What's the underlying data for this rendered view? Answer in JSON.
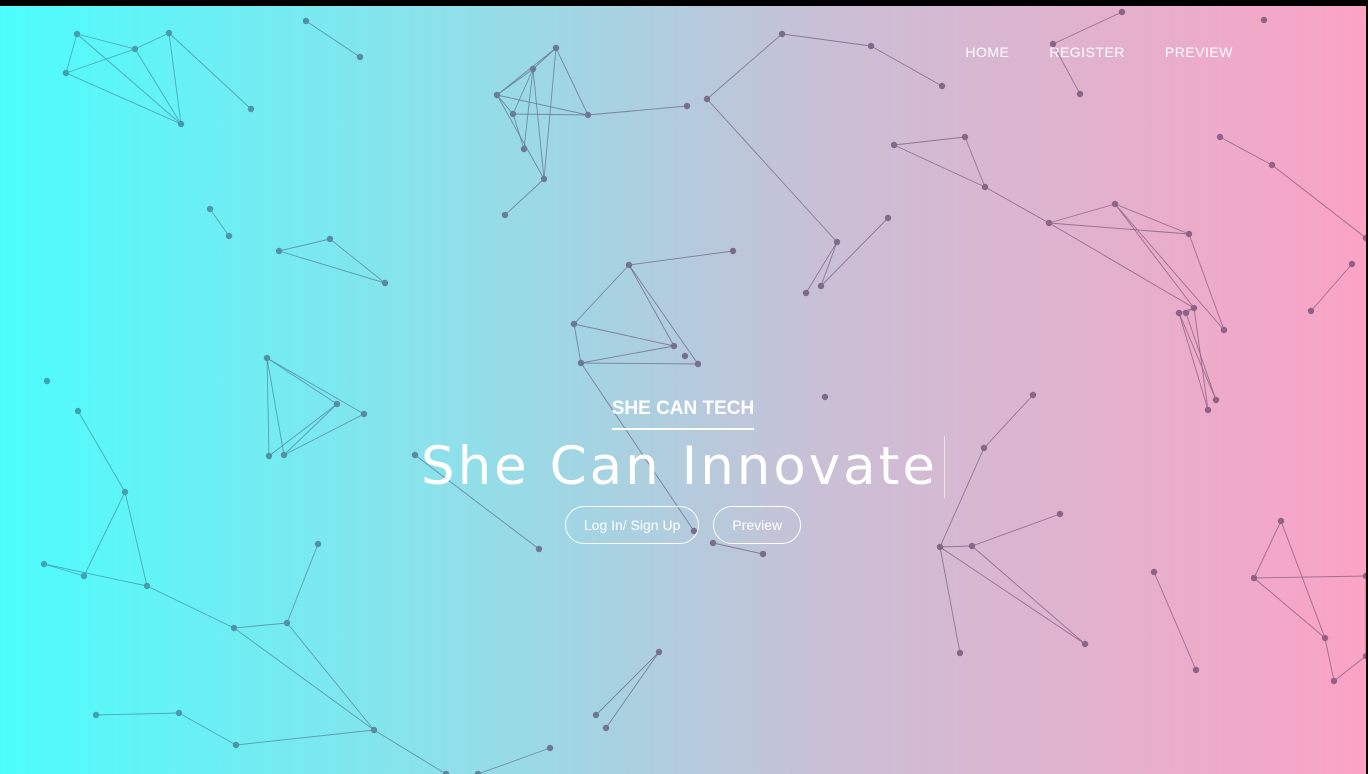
{
  "nav": {
    "items": [
      {
        "label": "HOME"
      },
      {
        "label": "REGISTER"
      },
      {
        "label": "PREVIEW"
      }
    ]
  },
  "hero": {
    "brand": "SHE CAN TECH",
    "headline": "She Can Innovate",
    "buttons": {
      "login": "Log In/ Sign Up",
      "preview": "Preview"
    }
  },
  "colors": {
    "gradient_left": "#4dfdfd",
    "gradient_right": "#fba3c5",
    "text": "#ffffff"
  }
}
